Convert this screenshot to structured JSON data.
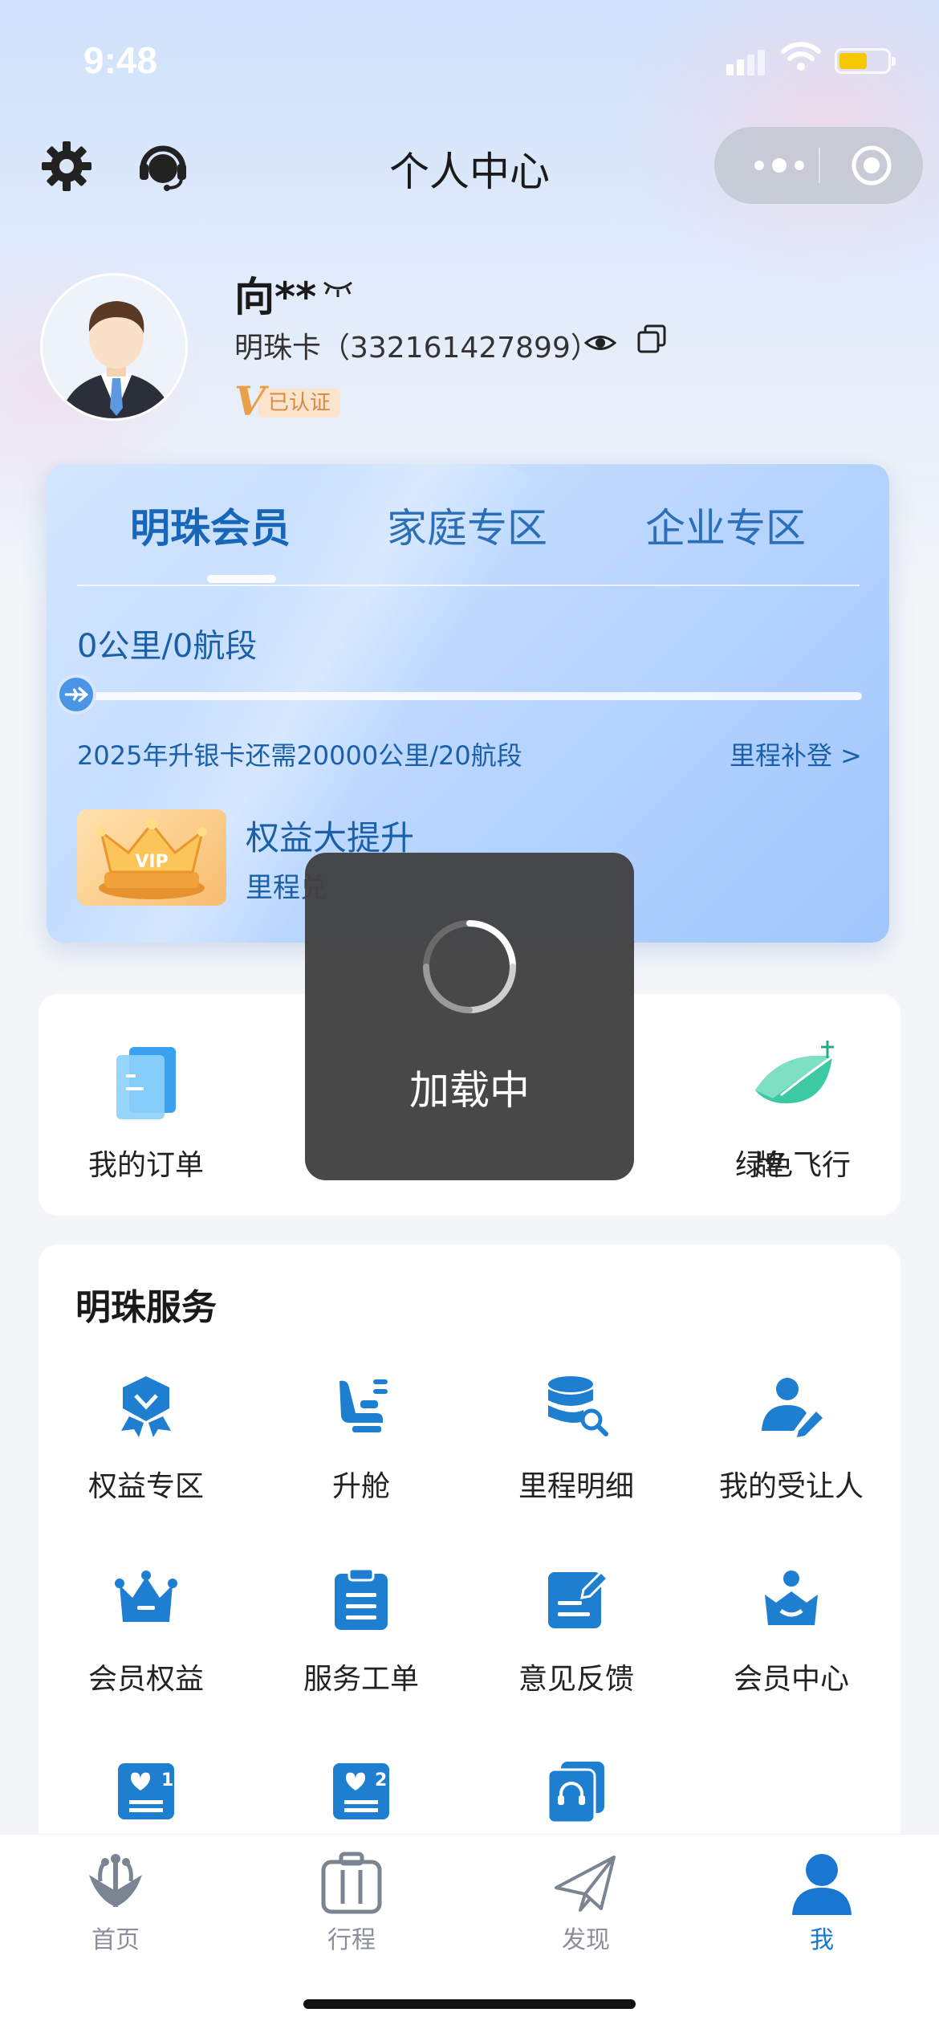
{
  "status_bar": {
    "time": "9:48"
  },
  "nav": {
    "title": "个人中心"
  },
  "profile": {
    "name": "向**",
    "card": "明珠卡（332161427899）",
    "verified_label": "已认证"
  },
  "member_card": {
    "tabs": [
      {
        "label": "明珠会员",
        "active": true
      },
      {
        "label": "家庭专区",
        "active": false
      },
      {
        "label": "企业专区",
        "active": false
      }
    ],
    "mileage": "0公里/0航段",
    "progress": 0,
    "upgrade_text": "2025年升银卡还需20000公里/20航段",
    "supplement_link": "里程补登 >",
    "benefit_title": "权益大提升",
    "benefit_sub": "里程兑",
    "vip_label": "VIP"
  },
  "quick_actions": [
    {
      "label": "我的订单",
      "icon": "order-icon"
    },
    {
      "label": "",
      "icon": ""
    },
    {
      "label": "牌",
      "icon": ""
    },
    {
      "label": "绿色飞行",
      "icon": "leaf-icon"
    }
  ],
  "services": {
    "title": "明珠服务",
    "items": [
      {
        "label": "权益专区",
        "icon": "badge-icon"
      },
      {
        "label": "升舱",
        "icon": "seat-icon"
      },
      {
        "label": "里程明细",
        "icon": "database-search-icon"
      },
      {
        "label": "我的受让人",
        "icon": "person-edit-icon"
      },
      {
        "label": "会员权益",
        "icon": "crown-icon"
      },
      {
        "label": "服务工单",
        "icon": "clipboard-icon"
      },
      {
        "label": "意见反馈",
        "icon": "feedback-icon"
      },
      {
        "label": "会员中心",
        "icon": "member-center-icon"
      },
      {
        "label": "",
        "icon": "heart-list-1-icon"
      },
      {
        "label": "",
        "icon": "heart-list-2-icon"
      },
      {
        "label": "",
        "icon": "customer-service-icon"
      }
    ]
  },
  "tabbar": [
    {
      "label": "首页",
      "icon": "kapok-logo-icon",
      "active": false
    },
    {
      "label": "行程",
      "icon": "suitcase-icon",
      "active": false
    },
    {
      "label": "发现",
      "icon": "paper-plane-icon",
      "active": false
    },
    {
      "label": "我",
      "icon": "person-icon",
      "active": true
    }
  ],
  "loading": {
    "text": "加载中"
  },
  "colors": {
    "accent": "#1976d2",
    "icon_blue": "#1e7fd0",
    "toast_bg": "#424242"
  }
}
